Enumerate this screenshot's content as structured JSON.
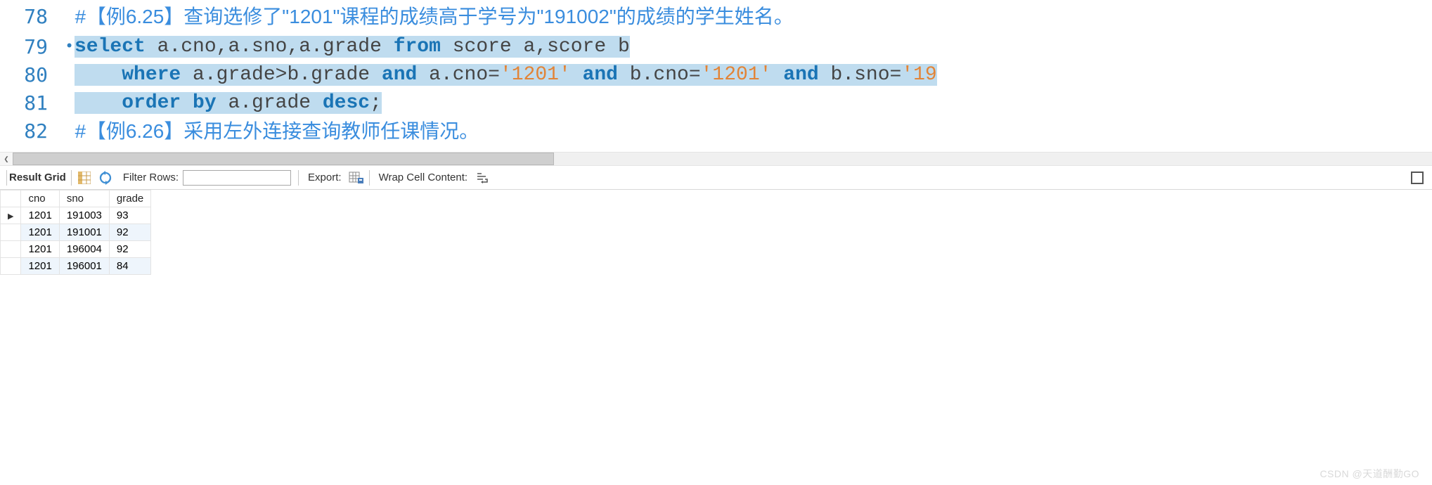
{
  "editor": {
    "lines": [
      {
        "num": "78",
        "bullet": "",
        "segments": [
          {
            "text": "#",
            "cls": "cmt-hash",
            "sel": false
          },
          {
            "text": "【例6.25】查询选修了\"1201\"课程的成绩高于学号为\"191002\"的成绩的学生姓名。",
            "cls": "cmt-text",
            "sel": false
          }
        ]
      },
      {
        "num": "79",
        "bullet": "•",
        "segments": [
          {
            "text": "select",
            "cls": "kw",
            "sel": true
          },
          {
            "text": " a.cno,a.sno,a.grade ",
            "cls": "plain",
            "sel": true
          },
          {
            "text": "from",
            "cls": "kw",
            "sel": true
          },
          {
            "text": " score a,score b",
            "cls": "plain",
            "sel": true
          }
        ]
      },
      {
        "num": "80",
        "bullet": "",
        "segments": [
          {
            "text": "    ",
            "cls": "plain",
            "sel": true
          },
          {
            "text": "where",
            "cls": "kw",
            "sel": true
          },
          {
            "text": " a.grade>b.grade ",
            "cls": "plain",
            "sel": true
          },
          {
            "text": "and",
            "cls": "kw",
            "sel": true
          },
          {
            "text": " a.cno=",
            "cls": "plain",
            "sel": true
          },
          {
            "text": "'1201'",
            "cls": "str",
            "sel": true
          },
          {
            "text": " ",
            "cls": "plain",
            "sel": true
          },
          {
            "text": "and",
            "cls": "kw",
            "sel": true
          },
          {
            "text": " b.cno=",
            "cls": "plain",
            "sel": true
          },
          {
            "text": "'1201'",
            "cls": "str",
            "sel": true
          },
          {
            "text": " ",
            "cls": "plain",
            "sel": true
          },
          {
            "text": "and",
            "cls": "kw",
            "sel": true
          },
          {
            "text": " b.sno=",
            "cls": "plain",
            "sel": true
          },
          {
            "text": "'19",
            "cls": "str",
            "sel": true
          }
        ]
      },
      {
        "num": "81",
        "bullet": "",
        "segments": [
          {
            "text": "    ",
            "cls": "plain",
            "sel": true
          },
          {
            "text": "order by",
            "cls": "kw",
            "sel": true
          },
          {
            "text": " a.grade ",
            "cls": "plain",
            "sel": true
          },
          {
            "text": "desc",
            "cls": "kw",
            "sel": true
          },
          {
            "text": ";",
            "cls": "plain",
            "sel": true
          }
        ]
      },
      {
        "num": "82",
        "bullet": "",
        "segments": [
          {
            "text": "#",
            "cls": "cmt-hash",
            "sel": false
          },
          {
            "text": "【例6.26】采用左外连接查询教师任课情况。",
            "cls": "cmt-text",
            "sel": false
          }
        ]
      }
    ]
  },
  "toolbar": {
    "result_grid": "Result Grid",
    "filter_label": "Filter Rows:",
    "filter_value": "",
    "export_label": "Export:",
    "wrap_label": "Wrap Cell Content:"
  },
  "grid": {
    "columns": [
      "cno",
      "sno",
      "grade"
    ],
    "rows": [
      {
        "values": [
          "1201",
          "191003",
          "93"
        ],
        "cursor": true,
        "striped": false
      },
      {
        "values": [
          "1201",
          "191001",
          "92"
        ],
        "cursor": false,
        "striped": true
      },
      {
        "values": [
          "1201",
          "196004",
          "92"
        ],
        "cursor": false,
        "striped": false
      },
      {
        "values": [
          "1201",
          "196001",
          "84"
        ],
        "cursor": false,
        "striped": true
      }
    ]
  },
  "watermark": "CSDN @天道酬勤GO"
}
